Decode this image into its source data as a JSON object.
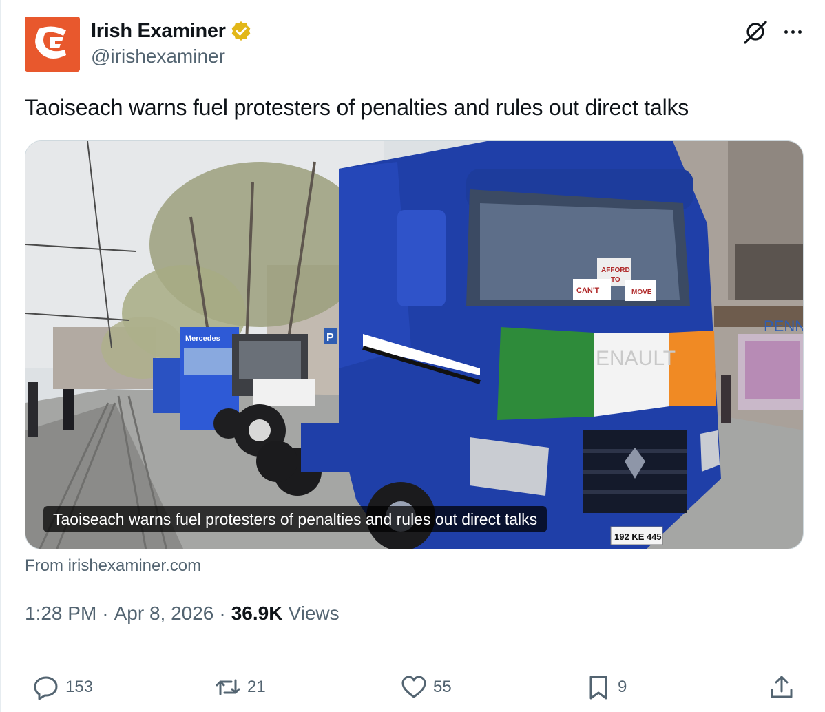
{
  "account": {
    "display_name": "Irish Examiner",
    "handle": "@irishexaminer",
    "verified": true,
    "verified_color": "#e2b719",
    "avatar_bg": "#e8582d",
    "avatar_icon": "irish-examiner-logo"
  },
  "tweet": {
    "text": "Taoiseach warns fuel protesters of penalties and rules out direct talks"
  },
  "card": {
    "caption": "Taoiseach warns fuel protesters of penalties and rules out direct talks",
    "source": "From irishexaminer.com",
    "image_text": {
      "sign_line_1": "AFFORD",
      "sign_line_2": "TO",
      "sign_line_3": "CAN'T",
      "sign_line_4": "MOVE",
      "flag_text": "ENAULT",
      "shop_sign": "PENN",
      "parking_sign": "P",
      "truck_logo": "Mercedes",
      "plate": "192 KE 445"
    }
  },
  "meta": {
    "time": "1:28 PM",
    "date": "Apr 8, 2026",
    "separator": "·",
    "views_count": "36.9K",
    "views_label": "Views"
  },
  "actions": {
    "reply_count": "153",
    "retweet_count": "21",
    "like_count": "55",
    "bookmark_count": "9"
  },
  "colors": {
    "text_primary": "#0f1419",
    "text_secondary": "#536471",
    "flag_green": "#2e8b3a",
    "flag_white": "#f3f3f3",
    "flag_orange": "#f08a24",
    "truck_blue": "#1f3fa8"
  }
}
